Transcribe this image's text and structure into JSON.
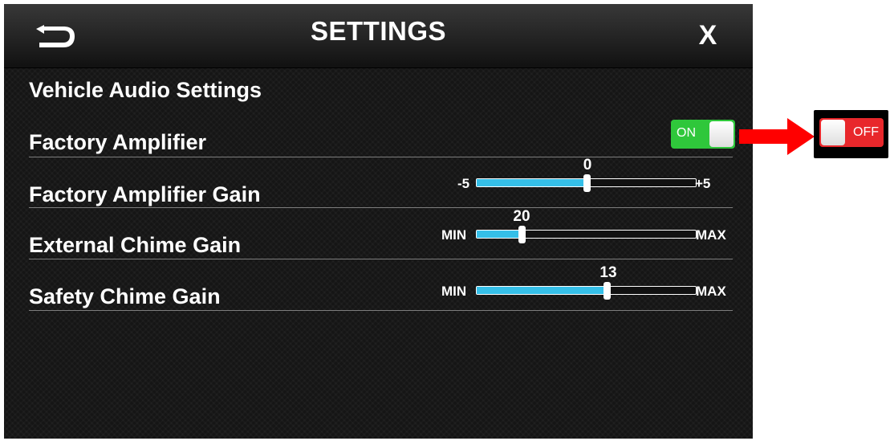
{
  "header": {
    "title": "SETTINGS",
    "back_icon": "back-arrow-icon",
    "close_label": "X"
  },
  "section_title": "Vehicle Audio Settings",
  "rows": {
    "factory_amplifier": {
      "label": "Factory Amplifier",
      "toggle": "ON",
      "toggle_state": true
    },
    "factory_amplifier_gain": {
      "label": "Factory Amplifier Gain",
      "min": "-5",
      "max": "+5",
      "value": "0",
      "range": [
        -5,
        5
      ],
      "fraction": 0.5
    },
    "external_chime_gain": {
      "label": "External Chime Gain",
      "min": "MIN",
      "max": "MAX",
      "value": "20",
      "fraction": 0.2
    },
    "safety_chime_gain": {
      "label": "Safety Chime Gain",
      "min": "MIN",
      "max": "MAX",
      "value": "13",
      "fraction": 0.6
    }
  },
  "callout": {
    "toggle": "OFF",
    "toggle_state": false,
    "arrow_color": "#ff0000"
  },
  "colors": {
    "accent_on": "#2fc73b",
    "accent_off": "#e8272b",
    "slider_fill": "#35bfe8"
  }
}
